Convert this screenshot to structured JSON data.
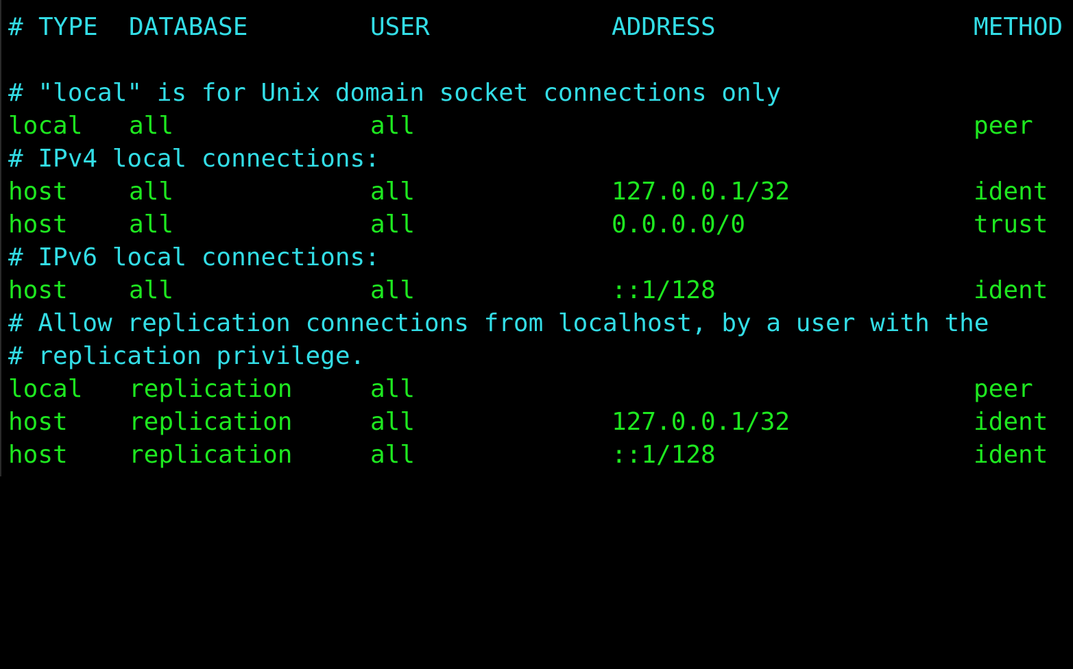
{
  "colors": {
    "background": "#000000",
    "comment": "#33dde6",
    "entry": "#1ee820"
  },
  "header": {
    "hash": "#",
    "type": "TYPE",
    "database": "DATABASE",
    "user": "USER",
    "address": "ADDRESS",
    "method": "METHOD"
  },
  "comments": {
    "local": "# \"local\" is for Unix domain socket connections only",
    "ipv4": "# IPv4 local connections:",
    "ipv6": "# IPv6 local connections:",
    "replication_1": "# Allow replication connections from localhost, by a user with the",
    "replication_2": "# replication privilege."
  },
  "entries": [
    {
      "type": "local",
      "database": "all",
      "user": "all",
      "address": "",
      "method": "peer"
    },
    {
      "type": "host",
      "database": "all",
      "user": "all",
      "address": "127.0.0.1/32",
      "method": "ident"
    },
    {
      "type": "host",
      "database": "all",
      "user": "all",
      "address": "0.0.0.0/0",
      "method": "trust"
    },
    {
      "type": "host",
      "database": "all",
      "user": "all",
      "address": "::1/128",
      "method": "ident"
    },
    {
      "type": "local",
      "database": "replication",
      "user": "all",
      "address": "",
      "method": "peer"
    },
    {
      "type": "host",
      "database": "replication",
      "user": "all",
      "address": "127.0.0.1/32",
      "method": "ident"
    },
    {
      "type": "host",
      "database": "replication",
      "user": "all",
      "address": "::1/128",
      "method": "ident"
    }
  ]
}
